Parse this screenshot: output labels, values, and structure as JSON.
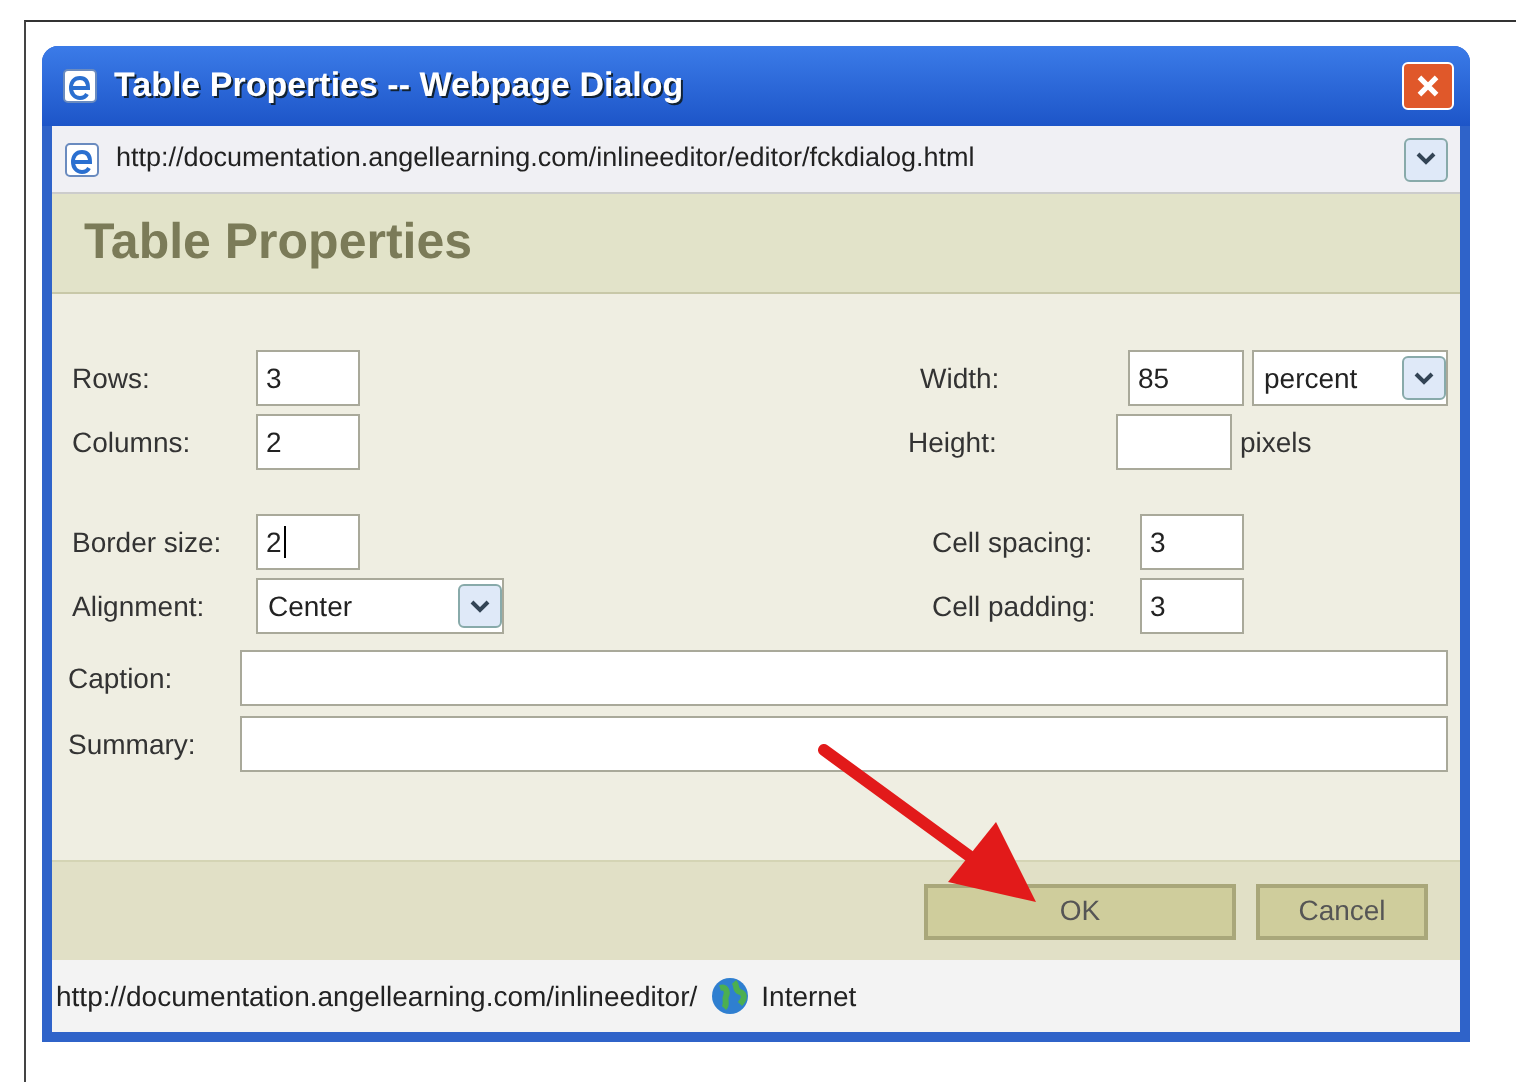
{
  "window": {
    "title": "Table Properties -- Webpage Dialog"
  },
  "address_bar": {
    "url": "http://documentation.angellearning.com/inlineeditor/editor/fckdialog.html"
  },
  "heading": "Table Properties",
  "field_groups": [
    {
      "rows": [
        {
          "left": {
            "label": "Rows:",
            "kind": "text",
            "value": "3",
            "focused": false
          },
          "right": {
            "label": "Width:",
            "kind": "text",
            "value": "85",
            "unit_select": "percent"
          }
        },
        {
          "left": {
            "label": "Columns:",
            "kind": "text",
            "value": "2",
            "focused": false
          },
          "right": {
            "label": "Height:",
            "kind": "text",
            "unit": "pixels"
          }
        }
      ]
    },
    {
      "rows": [
        {
          "left": {
            "label": "Border size:",
            "kind": "text",
            "value": "2",
            "focused": true
          },
          "right": {
            "label": "Cell spacing:",
            "kind": "text",
            "value": "3"
          }
        },
        {
          "left": {
            "label": "Alignment:",
            "kind": "select",
            "value": "Center"
          },
          "right": {
            "label": "Cell padding:",
            "kind": "text",
            "value": "3"
          }
        }
      ]
    }
  ],
  "wide_fields": [
    {
      "label": "Caption:"
    },
    {
      "label": "Summary:"
    }
  ],
  "buttons": [
    {
      "label": "OK",
      "kind": "ok"
    },
    {
      "label": "Cancel",
      "kind": "cancel"
    }
  ],
  "status_bar": {
    "url": "http://documentation.angellearning.com/inlineeditor/",
    "zone": "Internet"
  }
}
